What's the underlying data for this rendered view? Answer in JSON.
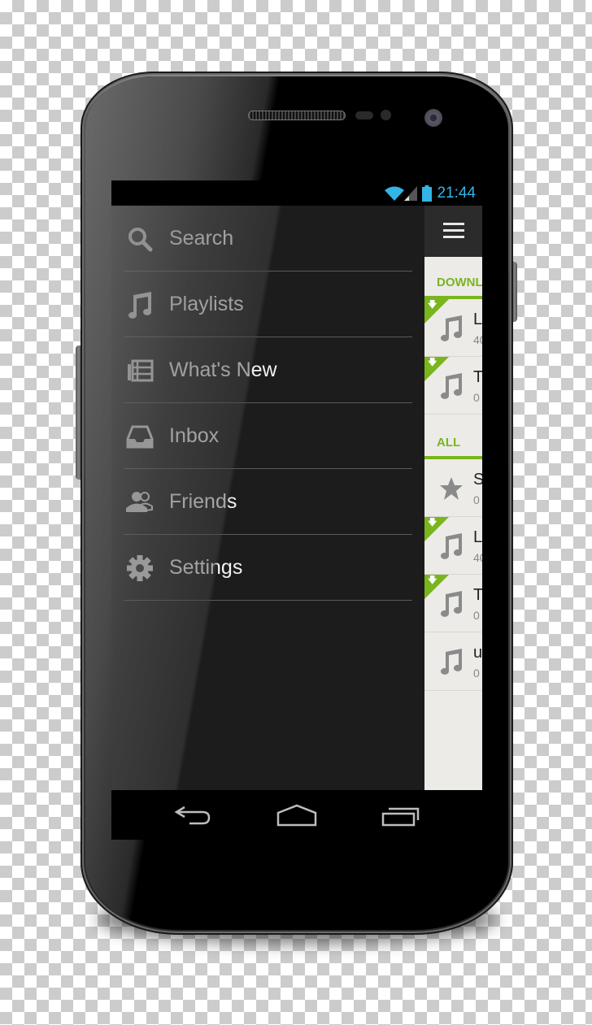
{
  "status_bar": {
    "wifi_icon": "wifi-icon",
    "signal_icon": "cell-signal-icon",
    "battery_icon": "battery-icon",
    "time": "21:44",
    "accent_color": "#33b5e5"
  },
  "drawer": {
    "items": [
      {
        "label": "Search",
        "icon": "search-icon"
      },
      {
        "label": "Playlists",
        "icon": "music-note-icon"
      },
      {
        "label": "What's New",
        "icon": "newspaper-icon"
      },
      {
        "label": "Inbox",
        "icon": "inbox-icon"
      },
      {
        "label": "Friends",
        "icon": "friends-icon"
      },
      {
        "label": "Settings",
        "icon": "gear-icon"
      }
    ]
  },
  "content": {
    "menu_icon": "hamburger-menu-icon",
    "accent_color": "#7ab51d",
    "sections": [
      {
        "header": "DOWNL",
        "rows": [
          {
            "title": "L",
            "sub": "40",
            "downloaded": true,
            "icon": "music-note-icon"
          },
          {
            "title": "T",
            "sub": "0",
            "downloaded": true,
            "icon": "music-note-icon"
          }
        ]
      },
      {
        "header": "ALL",
        "rows": [
          {
            "title": "S",
            "sub": "0",
            "downloaded": false,
            "icon": "star-icon"
          },
          {
            "title": "L",
            "sub": "40",
            "downloaded": true,
            "icon": "music-note-icon"
          },
          {
            "title": "T",
            "sub": "0",
            "downloaded": true,
            "icon": "music-note-icon"
          },
          {
            "title": "u",
            "sub": "0",
            "downloaded": false,
            "icon": "music-note-icon"
          }
        ]
      }
    ],
    "download_badge_glyph": "🡇"
  },
  "nav_bar": {
    "back": "back-icon",
    "home": "home-icon",
    "recents": "recent-apps-icon"
  }
}
